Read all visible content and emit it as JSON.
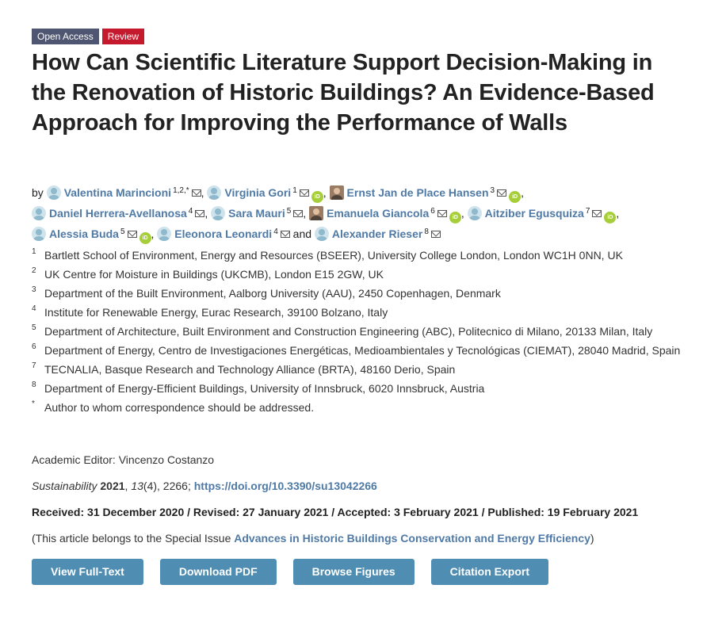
{
  "badges": {
    "open_access": "Open Access",
    "review": "Review"
  },
  "title": "How Can Scientific Literature Support Decision-Making in the Renovation of Historic Buildings? An Evidence-Based Approach for Improving the Performance of Walls",
  "by_label": "by",
  "and_label": "and",
  "authors": [
    {
      "name": "Valentina Marincioni",
      "sup": "1,2,*"
    },
    {
      "name": "Virginia Gori",
      "sup": "1"
    },
    {
      "name": "Ernst Jan de Place Hansen",
      "sup": "3"
    },
    {
      "name": "Daniel Herrera-Avellanosa",
      "sup": "4"
    },
    {
      "name": "Sara Mauri",
      "sup": "5"
    },
    {
      "name": "Emanuela Giancola",
      "sup": "6"
    },
    {
      "name": "Aitziber Egusquiza",
      "sup": "7"
    },
    {
      "name": "Alessia Buda",
      "sup": "5"
    },
    {
      "name": "Eleonora Leonardi",
      "sup": "4"
    },
    {
      "name": "Alexander Rieser",
      "sup": "8"
    }
  ],
  "affiliations": [
    {
      "num": "1",
      "text": "Bartlett School of Environment, Energy and Resources (BSEER), University College London, London WC1H 0NN, UK"
    },
    {
      "num": "2",
      "text": "UK Centre for Moisture in Buildings (UKCMB), London E15 2GW, UK"
    },
    {
      "num": "3",
      "text": "Department of the Built Environment, Aalborg University (AAU), 2450 Copenhagen, Denmark"
    },
    {
      "num": "4",
      "text": "Institute for Renewable Energy, Eurac Research, 39100 Bolzano, Italy"
    },
    {
      "num": "5",
      "text": "Department of Architecture, Built Environment and Construction Engineering (ABC), Politecnico di Milano, 20133 Milan, Italy"
    },
    {
      "num": "6",
      "text": "Department of Energy, Centro de Investigaciones Energéticas, Medioambientales y Tecnológicas (CIEMAT), 28040 Madrid, Spain"
    },
    {
      "num": "7",
      "text": "TECNALIA, Basque Research and Technology Alliance (BRTA), 48160 Derio, Spain"
    },
    {
      "num": "8",
      "text": "Department of Energy-Efficient Buildings, University of Innsbruck, 6020 Innsbruck, Austria"
    },
    {
      "num": "*",
      "text": "Author to whom correspondence should be addressed."
    }
  ],
  "editor": "Academic Editor: Vincenzo Costanzo",
  "citation": {
    "journal": "Sustainability",
    "year": "2021",
    "volume": "13",
    "rest": "(4), 2266;",
    "doi": "https://doi.org/10.3390/su13042266"
  },
  "dates": "Received: 31 December 2020 / Revised: 27 January 2021 / Accepted: 3 February 2021 / Published: 19 February 2021",
  "special_issue": {
    "prefix": "(This article belongs to the Special Issue ",
    "link": "Advances in Historic Buildings Conservation and Energy Efficiency",
    "suffix": ")"
  },
  "buttons": {
    "full_text": "View Full-Text",
    "pdf": "Download PDF",
    "figures": "Browse Figures",
    "export": "Citation Export"
  },
  "icons": {
    "orcid": "iD"
  },
  "colors": {
    "open_access": "#4f5671",
    "review": "#c5192d",
    "link": "#4f7aa6",
    "button": "#4f8db3",
    "orcid": "#a6ce39"
  }
}
